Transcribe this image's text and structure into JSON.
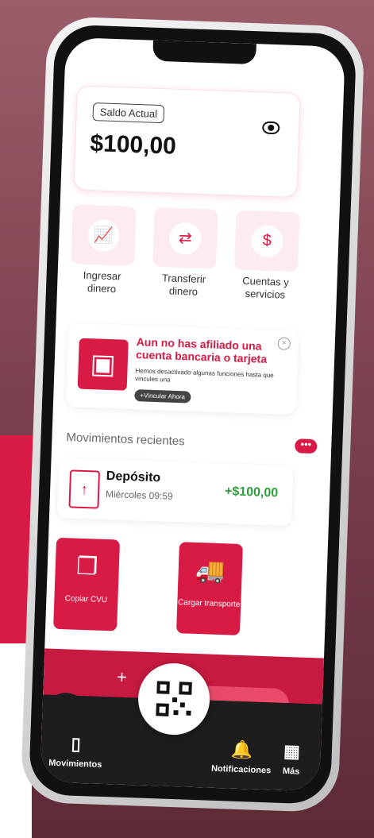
{
  "balance": {
    "label": "Saldo Actual",
    "amount": "$100,00"
  },
  "actions": [
    {
      "icon": "chart-icon",
      "label": "Ingresar dinero"
    },
    {
      "icon": "transfer-icon",
      "label": "Transferir dinero"
    },
    {
      "icon": "bill-icon",
      "label": "Cuentas y servicios"
    }
  ],
  "alert": {
    "title": "Aun no has afiliado una cuenta bancaria o tarjeta",
    "desc": "Hemos desactivado algunas funciones hasta que vincules una",
    "button": "+Vincular Ahora"
  },
  "recent": {
    "title": "Movimientos recientes",
    "more": "•••"
  },
  "movement": {
    "name": "Depósito",
    "date": "Miércoles 09:59",
    "amount": "+$100,00"
  },
  "quick": [
    {
      "icon": "copy-icon",
      "label": "Copiar CVU"
    },
    {
      "icon": "truck-icon",
      "label": "Cargar transporte"
    }
  ],
  "nav": {
    "movements": "Movimientos",
    "notifications": "Notificaciones",
    "more": "Más"
  },
  "colors": {
    "brand": "#d81b45",
    "positive": "#2e9d3c"
  }
}
